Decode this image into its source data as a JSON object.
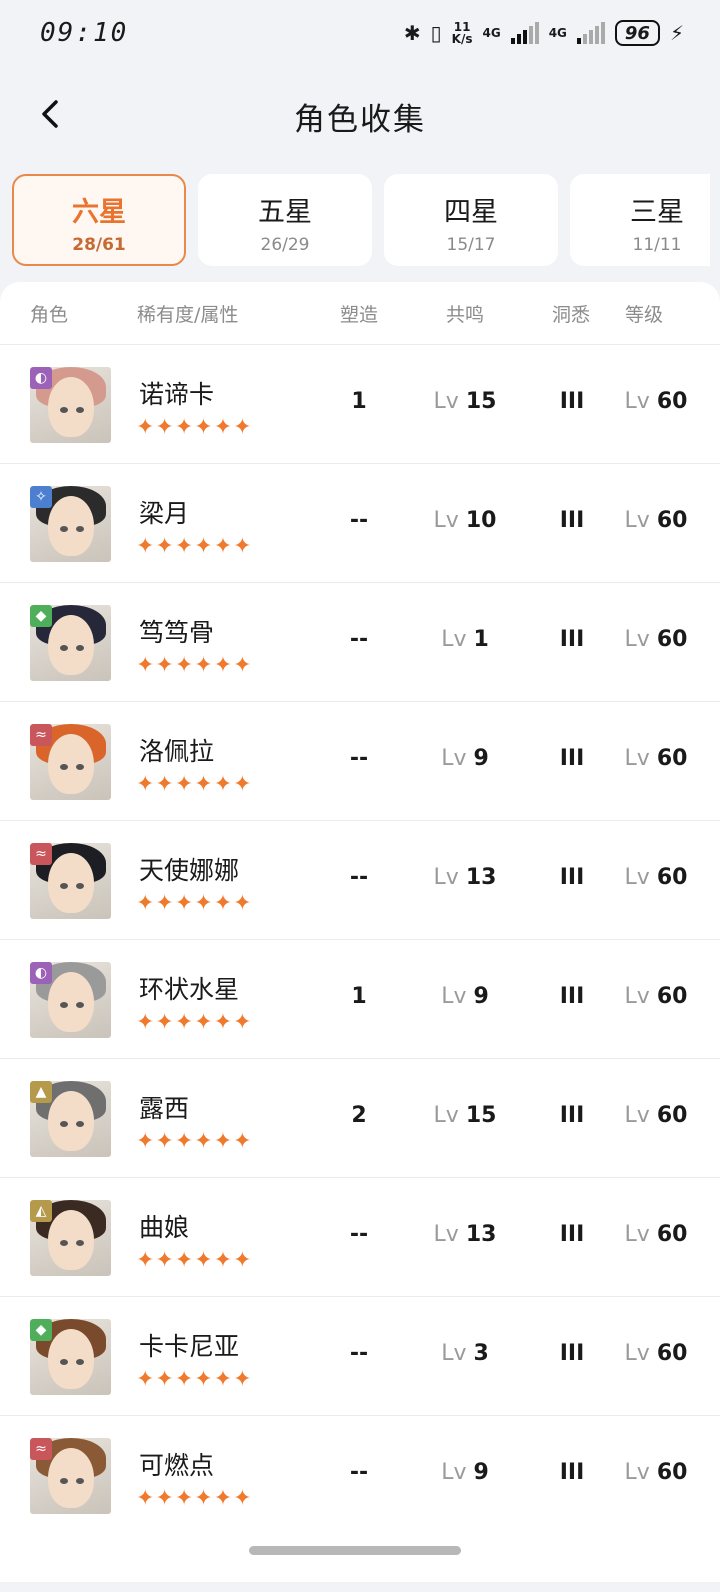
{
  "status": {
    "time": "09:10",
    "speed_top": "11",
    "speed_bottom": "K/s",
    "net1": "4G",
    "net2": "4G",
    "battery": "96"
  },
  "header": {
    "title": "角色收集"
  },
  "tabs": [
    {
      "label": "六星",
      "count": "28/61",
      "active": true
    },
    {
      "label": "五星",
      "count": "26/29",
      "active": false
    },
    {
      "label": "四星",
      "count": "15/17",
      "active": false
    },
    {
      "label": "三星",
      "count": "11/11",
      "active": false
    }
  ],
  "columns": {
    "role": "角色",
    "rarity": "稀有度/属性",
    "shape": "塑造",
    "resonance": "共鸣",
    "insight": "洞悉",
    "level": "等级"
  },
  "lv_prefix": "Lv",
  "rows": [
    {
      "name": "诺谛卡",
      "stars": "✦✦✦✦✦✦",
      "shape": "1",
      "resonance": "15",
      "insight": "III",
      "level": "60",
      "attr": "purple",
      "attr_icon": "◐",
      "hair": "#d49a8e"
    },
    {
      "name": "梁月",
      "stars": "✦✦✦✦✦✦",
      "shape": "--",
      "resonance": "10",
      "insight": "III",
      "level": "60",
      "attr": "blue",
      "attr_icon": "✧",
      "hair": "#2b2b2b"
    },
    {
      "name": "笃笃骨",
      "stars": "✦✦✦✦✦✦",
      "shape": "--",
      "resonance": "1",
      "insight": "III",
      "level": "60",
      "attr": "green",
      "attr_icon": "◆",
      "hair": "#27273a"
    },
    {
      "name": "洛佩拉",
      "stars": "✦✦✦✦✦✦",
      "shape": "--",
      "resonance": "9",
      "insight": "III",
      "level": "60",
      "attr": "red",
      "attr_icon": "≈",
      "hair": "#d9652a"
    },
    {
      "name": "天使娜娜",
      "stars": "✦✦✦✦✦✦",
      "shape": "--",
      "resonance": "13",
      "insight": "III",
      "level": "60",
      "attr": "red",
      "attr_icon": "≈",
      "hair": "#1d1d24"
    },
    {
      "name": "环状水星",
      "stars": "✦✦✦✦✦✦",
      "shape": "1",
      "resonance": "9",
      "insight": "III",
      "level": "60",
      "attr": "purple",
      "attr_icon": "◐",
      "hair": "#9a9a9a"
    },
    {
      "name": "露西",
      "stars": "✦✦✦✦✦✦",
      "shape": "2",
      "resonance": "15",
      "insight": "III",
      "level": "60",
      "attr": "gold",
      "attr_icon": "▲",
      "hair": "#6f6f6f"
    },
    {
      "name": "曲娘",
      "stars": "✦✦✦✦✦✦",
      "shape": "--",
      "resonance": "13",
      "insight": "III",
      "level": "60",
      "attr": "gold",
      "attr_icon": "◭",
      "hair": "#3a2a22"
    },
    {
      "name": "卡卡尼亚",
      "stars": "✦✦✦✦✦✦",
      "shape": "--",
      "resonance": "3",
      "insight": "III",
      "level": "60",
      "attr": "green",
      "attr_icon": "◆",
      "hair": "#7a4a2c"
    },
    {
      "name": "可燃点",
      "stars": "✦✦✦✦✦✦",
      "shape": "--",
      "resonance": "9",
      "insight": "III",
      "level": "60",
      "attr": "red",
      "attr_icon": "≈",
      "hair": "#8a5a36"
    }
  ],
  "colors": {
    "accent": "#e8742f",
    "purple": "#9b62b8",
    "blue": "#4d7fd1",
    "green": "#4fae5a",
    "red": "#c8565a",
    "gold": "#b69a4c"
  }
}
